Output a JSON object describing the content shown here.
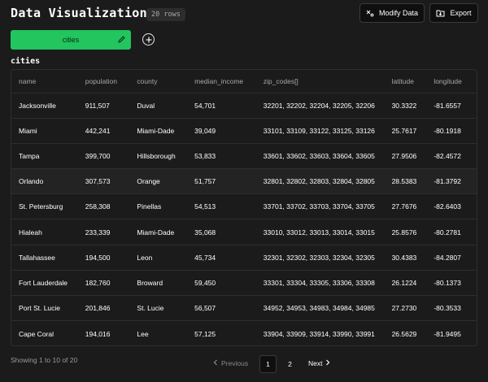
{
  "header": {
    "title": "Data Visualization",
    "rows_badge": "20 rows",
    "modify_label": "Modify Data",
    "export_label": "Export"
  },
  "tabs": [
    {
      "label": "cities"
    }
  ],
  "table": {
    "title": "cities",
    "columns": [
      "name",
      "population",
      "county",
      "median_income",
      "zip_codes[]",
      "latitude",
      "longitude"
    ],
    "rows": [
      [
        "Jacksonville",
        "911,507",
        "Duval",
        "54,701",
        "32201, 32202, 32204, 32205, 32206",
        "30.3322",
        "-81.6557"
      ],
      [
        "Miami",
        "442,241",
        "Miami-Dade",
        "39,049",
        "33101, 33109, 33122, 33125, 33126",
        "25.7617",
        "-80.1918"
      ],
      [
        "Tampa",
        "399,700",
        "Hillsborough",
        "53,833",
        "33601, 33602, 33603, 33604, 33605",
        "27.9506",
        "-82.4572"
      ],
      [
        "Orlando",
        "307,573",
        "Orange",
        "51,757",
        "32801, 32802, 32803, 32804, 32805",
        "28.5383",
        "-81.3792"
      ],
      [
        "St. Petersburg",
        "258,308",
        "Pinellas",
        "54,513",
        "33701, 33702, 33703, 33704, 33705",
        "27.7676",
        "-82.6403"
      ],
      [
        "Hialeah",
        "233,339",
        "Miami-Dade",
        "35,068",
        "33010, 33012, 33013, 33014, 33015",
        "25.8576",
        "-80.2781"
      ],
      [
        "Tallahassee",
        "194,500",
        "Leon",
        "45,734",
        "32301, 32302, 32303, 32304, 32305",
        "30.4383",
        "-84.2807"
      ],
      [
        "Fort Lauderdale",
        "182,760",
        "Broward",
        "59,450",
        "33301, 33304, 33305, 33306, 33308",
        "26.1224",
        "-80.1373"
      ],
      [
        "Port St. Lucie",
        "201,846",
        "St. Lucie",
        "56,507",
        "34952, 34953, 34983, 34984, 34985",
        "27.2730",
        "-80.3533"
      ],
      [
        "Cape Coral",
        "194,016",
        "Lee",
        "57,125",
        "33904, 33909, 33914, 33990, 33991",
        "26.5629",
        "-81.9495"
      ]
    ]
  },
  "footer": {
    "info": "Showing 1 to 10 of 20",
    "prev_label": "Previous",
    "next_label": "Next",
    "pages": [
      "1",
      "2"
    ]
  },
  "colors": {
    "accent": "#22c55e",
    "background": "#1b1b1b",
    "border": "#2e2e2e"
  },
  "icons": [
    "modify-data-icon",
    "export-icon",
    "edit-pencil-icon",
    "plus-circle-icon",
    "chevron-left-icon",
    "chevron-right-icon"
  ]
}
